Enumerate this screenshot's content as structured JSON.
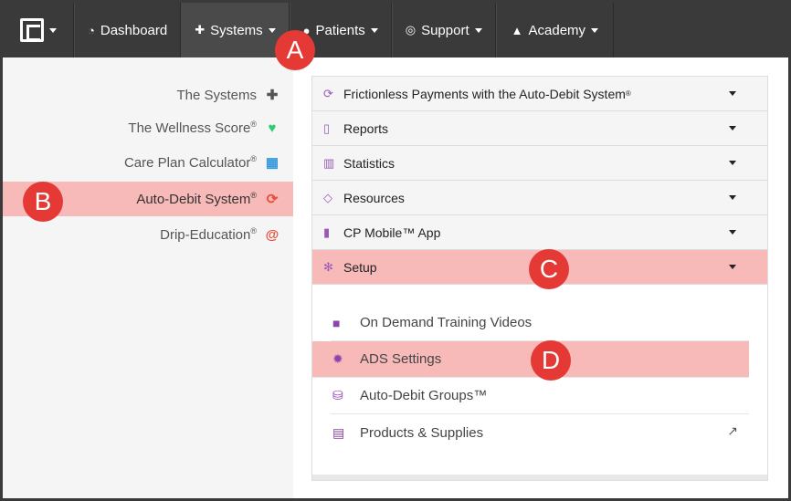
{
  "nav": {
    "items": [
      {
        "label": "Dashboard",
        "icon": "dashboard-icon"
      },
      {
        "label": "Systems",
        "icon": "puzzle-icon"
      },
      {
        "label": "Patients",
        "icon": "users-icon"
      },
      {
        "label": "Support",
        "icon": "lifebuoy-icon"
      },
      {
        "label": "Academy",
        "icon": "graduation-cap-icon"
      }
    ]
  },
  "sidebar": {
    "items": [
      {
        "label": "The Systems",
        "mark": "",
        "icon": "puzzle-icon",
        "color": "#555555"
      },
      {
        "label": "The Wellness Score",
        "mark": "®",
        "icon": "heart-pulse-icon",
        "color": "#2ecc71"
      },
      {
        "label": "Care Plan Calculator",
        "mark": "®",
        "icon": "calculator-icon",
        "color": "#3498db"
      },
      {
        "label": "Auto-Debit System",
        "mark": "®",
        "icon": "refresh-icon",
        "color": "#e74c3c"
      },
      {
        "label": "Drip-Education",
        "mark": "®",
        "icon": "at-icon",
        "color": "#e74c3c"
      }
    ]
  },
  "panel": {
    "rows": [
      {
        "label": "Frictionless Payments with the Auto-Debit System",
        "mark": "®",
        "icon": "refresh-icon"
      },
      {
        "label": "Reports",
        "mark": "",
        "icon": "file-icon"
      },
      {
        "label": "Statistics",
        "mark": "",
        "icon": "bar-chart-icon"
      },
      {
        "label": "Resources",
        "mark": "",
        "icon": "diamond-icon"
      },
      {
        "label": "CP Mobile™ App",
        "mark": "",
        "icon": "mobile-icon"
      },
      {
        "label": "Setup",
        "mark": "",
        "icon": "gears-icon"
      }
    ],
    "sub_items": [
      {
        "label": "On Demand Training Videos",
        "icon": "video-camera-icon"
      },
      {
        "label": "ADS Settings",
        "icon": "gear-icon"
      },
      {
        "label": "Auto-Debit Groups™",
        "icon": "database-icon"
      },
      {
        "label": "Products & Supplies",
        "icon": "basket-icon"
      }
    ]
  },
  "markers": {
    "a": "A",
    "b": "B",
    "c": "C",
    "d": "D"
  },
  "colors": {
    "highlight": "#f8b9b9",
    "marker": "#e53935",
    "accent": "#9b59b6"
  }
}
